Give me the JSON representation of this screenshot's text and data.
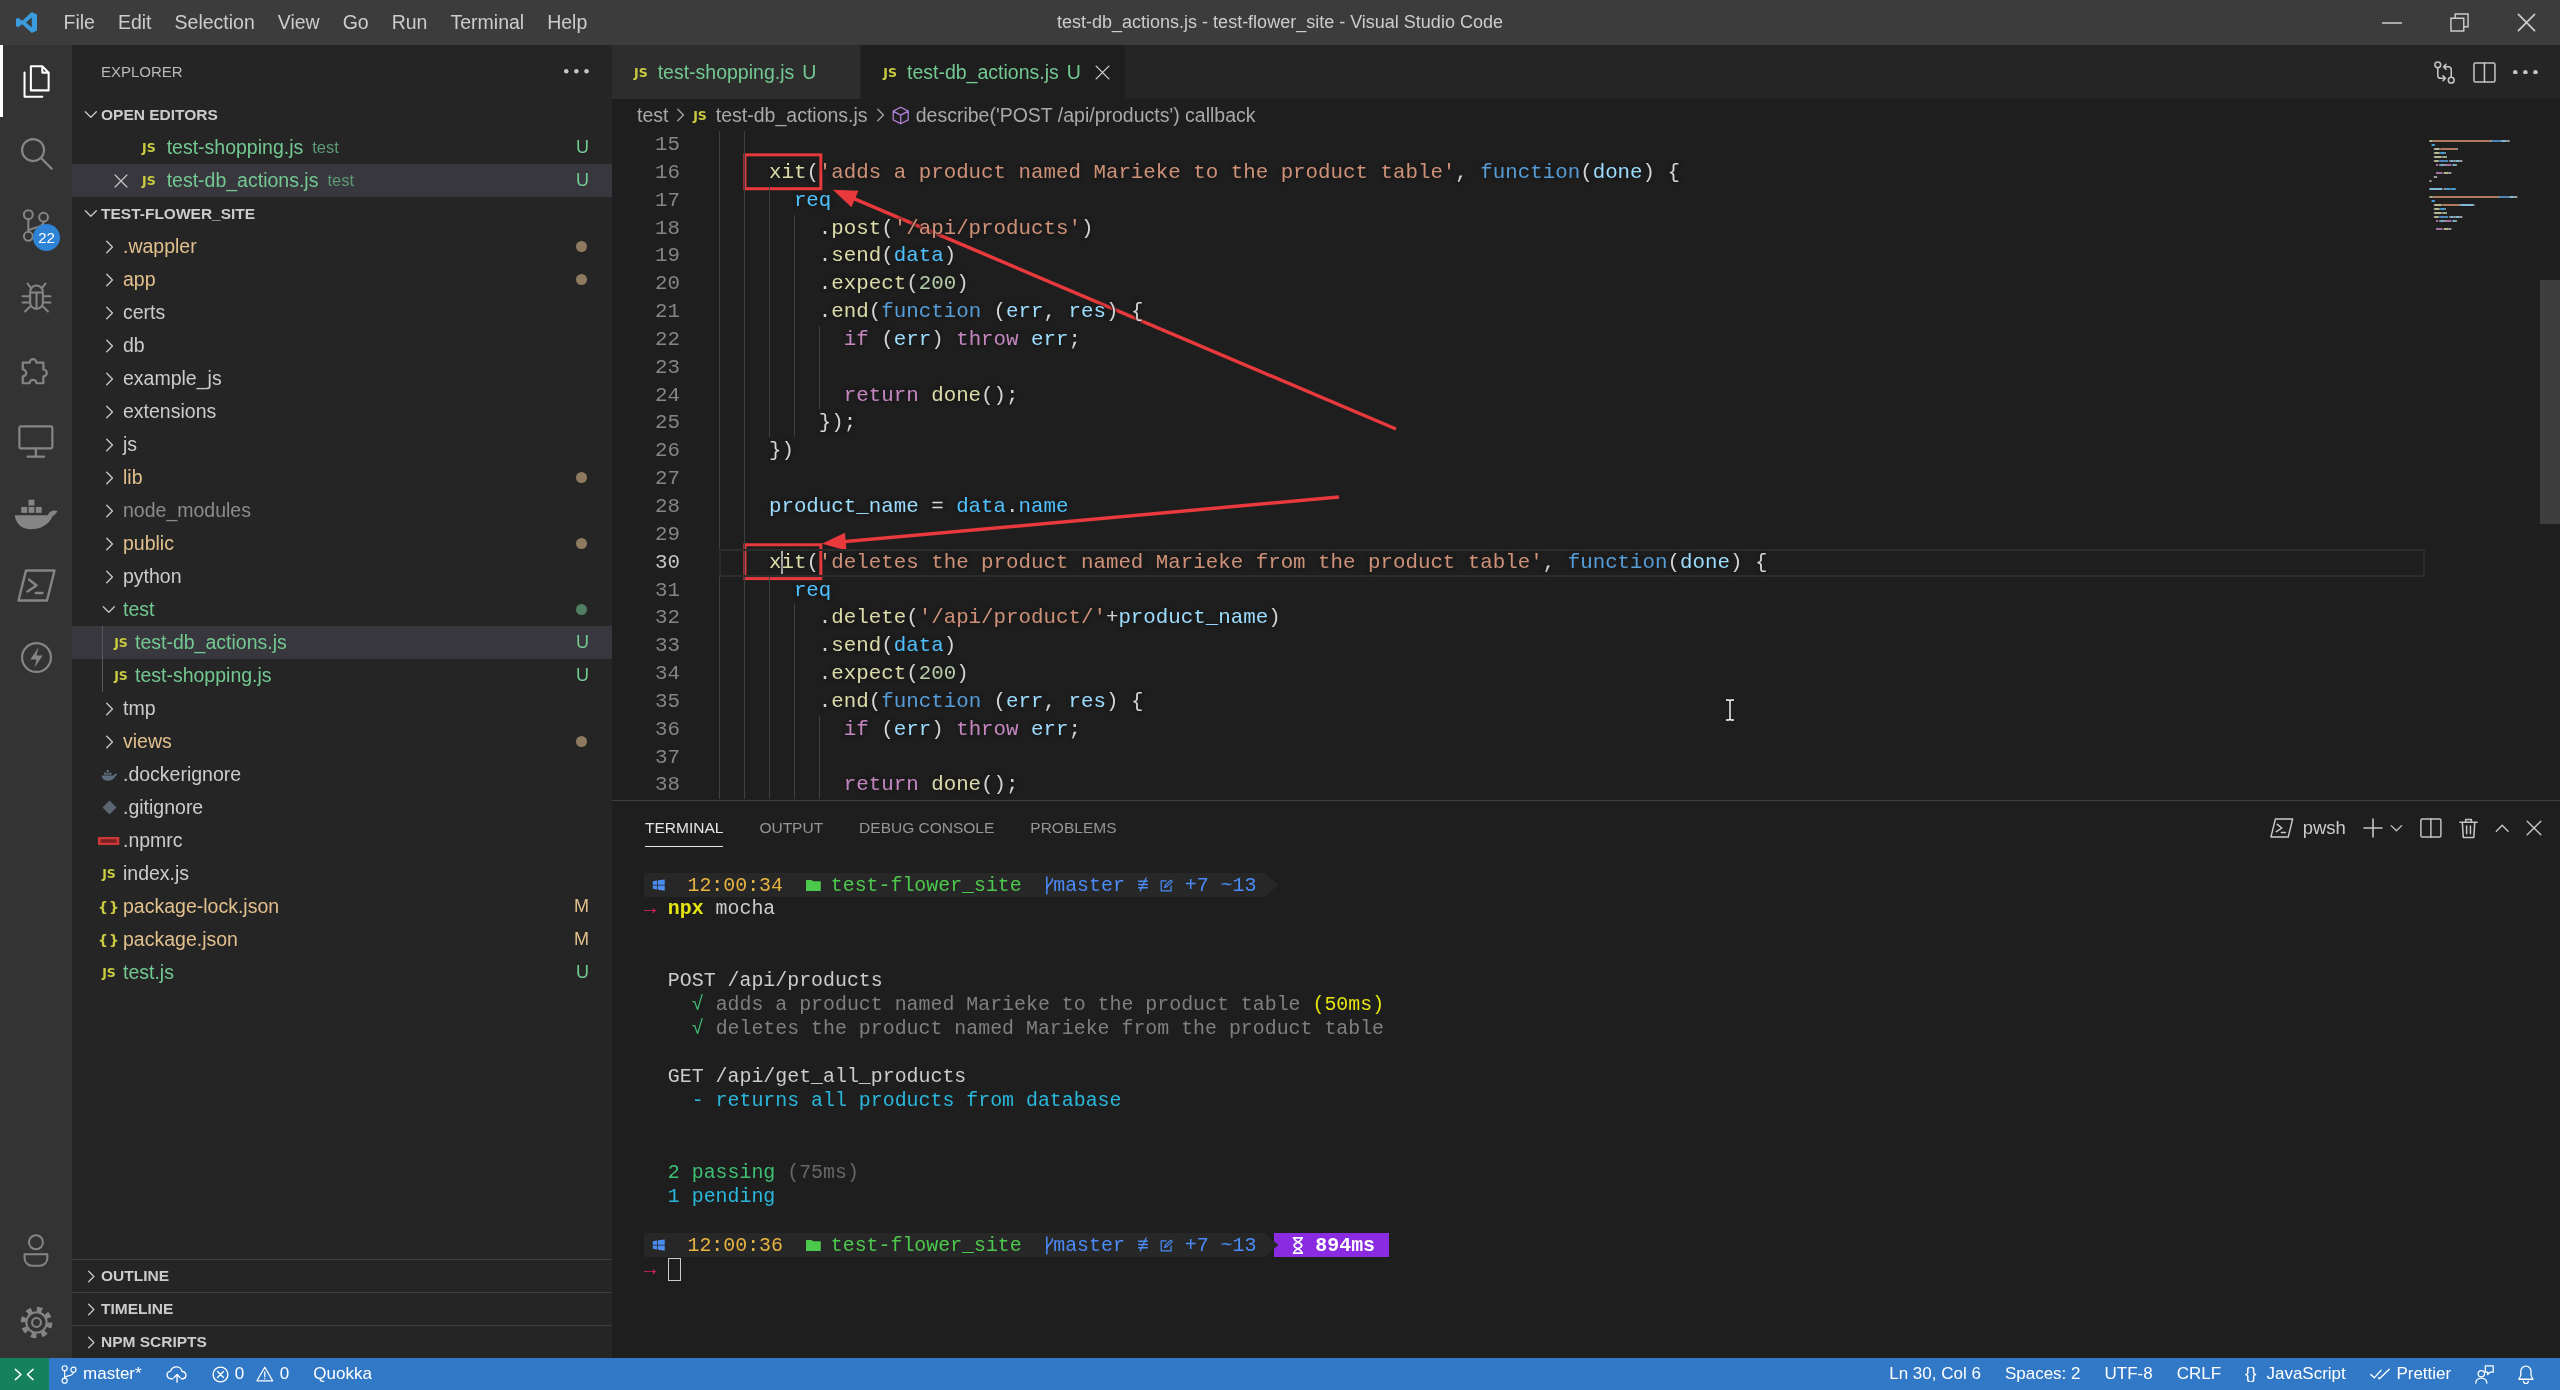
{
  "title_bar": {
    "menu": [
      "File",
      "Edit",
      "Selection",
      "View",
      "Go",
      "Run",
      "Terminal",
      "Help"
    ],
    "title": "test-db_actions.js - test-flower_site - Visual Studio Code"
  },
  "activity_bar": {
    "items": [
      {
        "kind": "files",
        "selected": true
      },
      {
        "kind": "search",
        "selected": false
      },
      {
        "kind": "branches",
        "selected": false,
        "badge": "22"
      },
      {
        "kind": "bug",
        "selected": false
      },
      {
        "kind": "puzzle",
        "selected": false
      },
      {
        "kind": "monitor",
        "selected": false
      },
      {
        "kind": "whale",
        "selected": false
      },
      {
        "kind": "terminal",
        "selected": false
      },
      {
        "kind": "lightning",
        "selected": false
      }
    ],
    "bottom": [
      {
        "kind": "person"
      },
      {
        "kind": "gear"
      }
    ]
  },
  "sidebar": {
    "title": "EXPLORER",
    "open_editors": {
      "title": "OPEN EDITORS",
      "expanded": true,
      "items": [
        {
          "kind": "js-file",
          "icon_text": "JS",
          "name": "test-shopping.js",
          "folder": "test",
          "badge": "U",
          "color": "#73c991",
          "selected": false
        },
        {
          "kind": "js-file",
          "icon_text": "JS",
          "name": "test-db_actions.js",
          "folder": "test",
          "badge": "U",
          "color": "#73c991",
          "selected": true
        }
      ]
    },
    "folder": {
      "title": "TEST-FLOWER_SITE",
      "expanded": true,
      "items": [
        {
          "kind": "folder",
          "name": ".wappler",
          "expanded": false,
          "color": "#e2c08d",
          "changed": true,
          "selected": false
        },
        {
          "kind": "folder",
          "name": "app",
          "expanded": false,
          "color": "#e2c08d",
          "changed": true,
          "selected": false
        },
        {
          "kind": "folder",
          "name": "certs",
          "expanded": false,
          "color": "#cccccc",
          "changed": false,
          "selected": false
        },
        {
          "kind": "folder",
          "name": "db",
          "expanded": false,
          "color": "#cccccc",
          "changed": false,
          "selected": false
        },
        {
          "kind": "folder",
          "name": "example_js",
          "expanded": false,
          "color": "#cccccc",
          "changed": false,
          "selected": false
        },
        {
          "kind": "folder",
          "name": "extensions",
          "expanded": false,
          "color": "#cccccc",
          "changed": false,
          "selected": false
        },
        {
          "kind": "folder",
          "name": "js",
          "expanded": false,
          "color": "#cccccc",
          "changed": false,
          "selected": false
        },
        {
          "kind": "folder",
          "name": "lib",
          "expanded": false,
          "color": "#e2c08d",
          "changed": true,
          "selected": false
        },
        {
          "kind": "folder",
          "name": "node_modules",
          "expanded": false,
          "color": "#8c8c8c",
          "changed": false,
          "selected": false
        },
        {
          "kind": "folder",
          "name": "public",
          "expanded": false,
          "color": "#e2c08d",
          "changed": true,
          "selected": false
        },
        {
          "kind": "folder",
          "name": "python",
          "expanded": false,
          "color": "#cccccc",
          "changed": false,
          "selected": false
        },
        {
          "kind": "folder",
          "name": "test",
          "expanded": true,
          "color": "#73c991",
          "changed": true,
          "selected": false,
          "children": [
            {
              "kind": "js-file",
              "icon_text": "JS",
              "name": "test-db_actions.js",
              "badge": "U",
              "color": "#73c991",
              "selected": true
            },
            {
              "kind": "js-file",
              "icon_text": "JS",
              "name": "test-shopping.js",
              "badge": "U",
              "color": "#73c991",
              "selected": false
            }
          ]
        },
        {
          "kind": "folder",
          "name": "tmp",
          "expanded": false,
          "color": "#cccccc",
          "changed": false,
          "selected": false
        },
        {
          "kind": "folder",
          "name": "views",
          "expanded": false,
          "color": "#e2c08d",
          "changed": true,
          "selected": false
        },
        {
          "kind": "docker-file",
          "name": ".dockerignore",
          "color": "#cccccc",
          "selected": false
        },
        {
          "kind": "git-file",
          "name": ".gitignore",
          "color": "#cccccc",
          "selected": false
        },
        {
          "kind": "npm-file",
          "name": ".npmrc",
          "color": "#cccccc",
          "selected": false
        },
        {
          "kind": "js-file",
          "icon_text": "JS",
          "name": "index.js",
          "color": "#cccccc",
          "selected": false
        },
        {
          "kind": "json-file",
          "icon_text": "{}",
          "name": "package-lock.json",
          "badge": "M",
          "color": "#e2c08d",
          "selected": false
        },
        {
          "kind": "json-file",
          "icon_text": "{}",
          "name": "package.json",
          "badge": "M",
          "color": "#e2c08d",
          "selected": false
        },
        {
          "kind": "js-file",
          "icon_text": "JS",
          "name": "test.js",
          "badge": "U",
          "color": "#73c991",
          "selected": false
        }
      ]
    },
    "sections": [
      {
        "title": "OUTLINE",
        "expanded": false
      },
      {
        "title": "TIMELINE",
        "expanded": false
      },
      {
        "title": "NPM SCRIPTS",
        "expanded": false
      }
    ]
  },
  "editor": {
    "tabs": [
      {
        "icon_text": "JS",
        "label": "test-shopping.js",
        "badge": "U",
        "selected": false
      },
      {
        "icon_text": "JS",
        "label": "test-db_actions.js",
        "badge": "U",
        "selected": true
      }
    ],
    "breadcrumb": [
      {
        "kind": "folder",
        "label": "test"
      },
      {
        "kind": "file",
        "icon_text": "JS",
        "label": "test-db_actions.js"
      },
      {
        "kind": "symbol",
        "label": "describe('POST /api/products') callback"
      }
    ],
    "lines": [
      {
        "number": "15",
        "current": false,
        "callout": false
      },
      {
        "number": "16",
        "current": false,
        "callout": true,
        "tokens": [
          {
            "kind": "function",
            "text": "    xit"
          },
          {
            "kind": "plain",
            "text": "("
          },
          {
            "kind": "string",
            "text": "'adds a product named Marieke to the product table'"
          },
          {
            "kind": "plain",
            "text": ", "
          },
          {
            "kind": "keyword",
            "text": "function"
          },
          {
            "kind": "plain",
            "text": "("
          },
          {
            "kind": "variable",
            "text": "done"
          },
          {
            "kind": "plain",
            "text": ") {"
          }
        ]
      },
      {
        "number": "17",
        "current": false,
        "callout": false,
        "tokens": [
          {
            "kind": "constant",
            "text": "      req"
          }
        ]
      },
      {
        "number": "18",
        "current": false,
        "callout": false,
        "tokens": [
          {
            "kind": "plain",
            "text": "        ."
          },
          {
            "kind": "function",
            "text": "post"
          },
          {
            "kind": "plain",
            "text": "("
          },
          {
            "kind": "string",
            "text": "'/api/products'"
          },
          {
            "kind": "plain",
            "text": ")"
          }
        ]
      },
      {
        "number": "19",
        "current": false,
        "callout": false,
        "tokens": [
          {
            "kind": "plain",
            "text": "        ."
          },
          {
            "kind": "function",
            "text": "send"
          },
          {
            "kind": "plain",
            "text": "("
          },
          {
            "kind": "constant",
            "text": "data"
          },
          {
            "kind": "plain",
            "text": ")"
          }
        ]
      },
      {
        "number": "20",
        "current": false,
        "callout": false,
        "tokens": [
          {
            "kind": "plain",
            "text": "        ."
          },
          {
            "kind": "function",
            "text": "expect"
          },
          {
            "kind": "plain",
            "text": "("
          },
          {
            "kind": "number",
            "text": "200"
          },
          {
            "kind": "plain",
            "text": ")"
          }
        ]
      },
      {
        "number": "21",
        "current": false,
        "callout": false,
        "tokens": [
          {
            "kind": "plain",
            "text": "        ."
          },
          {
            "kind": "function",
            "text": "end"
          },
          {
            "kind": "plain",
            "text": "("
          },
          {
            "kind": "keyword",
            "text": "function"
          },
          {
            "kind": "plain",
            "text": " ("
          },
          {
            "kind": "variable",
            "text": "err"
          },
          {
            "kind": "plain",
            "text": ", "
          },
          {
            "kind": "variable",
            "text": "res"
          },
          {
            "kind": "plain",
            "text": ") {"
          }
        ]
      },
      {
        "number": "22",
        "current": false,
        "callout": false,
        "tokens": [
          {
            "kind": "control",
            "text": "          if"
          },
          {
            "kind": "plain",
            "text": " ("
          },
          {
            "kind": "variable",
            "text": "err"
          },
          {
            "kind": "plain",
            "text": ") "
          },
          {
            "kind": "control",
            "text": "throw"
          },
          {
            "kind": "variable",
            "text": " err"
          },
          {
            "kind": "plain",
            "text": ";"
          }
        ]
      },
      {
        "number": "23",
        "current": false,
        "callout": false
      },
      {
        "number": "24",
        "current": false,
        "callout": false,
        "tokens": [
          {
            "kind": "control",
            "text": "          return"
          },
          {
            "kind": "function",
            "text": " done"
          },
          {
            "kind": "plain",
            "text": "();"
          }
        ]
      },
      {
        "number": "25",
        "current": false,
        "callout": false,
        "tokens": [
          {
            "kind": "plain",
            "text": "        });"
          }
        ]
      },
      {
        "number": "26",
        "current": false,
        "callout": false,
        "tokens": [
          {
            "kind": "plain",
            "text": "    })"
          }
        ]
      },
      {
        "number": "27",
        "current": false,
        "callout": false
      },
      {
        "number": "28",
        "current": false,
        "callout": false,
        "tokens": [
          {
            "kind": "variable",
            "text": "    product_name"
          },
          {
            "kind": "plain",
            "text": " = "
          },
          {
            "kind": "constant",
            "text": "data"
          },
          {
            "kind": "plain",
            "text": "."
          },
          {
            "kind": "constant",
            "text": "name"
          }
        ]
      },
      {
        "number": "29",
        "current": false,
        "callout": false
      },
      {
        "number": "30",
        "current": true,
        "callout": true,
        "tokens": [
          {
            "kind": "function",
            "text": "    x"
          },
          {
            "kind": "caret"
          },
          {
            "kind": "function",
            "text": "it"
          },
          {
            "kind": "plain",
            "text": "("
          },
          {
            "kind": "string",
            "text": "'deletes the product named Marieke from the product table'"
          },
          {
            "kind": "plain",
            "text": ", "
          },
          {
            "kind": "keyword",
            "text": "function"
          },
          {
            "kind": "plain",
            "text": "("
          },
          {
            "kind": "variable",
            "text": "done"
          },
          {
            "kind": "plain",
            "text": ") {"
          }
        ]
      },
      {
        "number": "31",
        "current": false,
        "callout": false,
        "tokens": [
          {
            "kind": "constant",
            "text": "      req"
          }
        ]
      },
      {
        "number": "32",
        "current": false,
        "callout": false,
        "tokens": [
          {
            "kind": "plain",
            "text": "        ."
          },
          {
            "kind": "function",
            "text": "delete"
          },
          {
            "kind": "plain",
            "text": "("
          },
          {
            "kind": "string",
            "text": "'/api/product/'"
          },
          {
            "kind": "plain",
            "text": "+"
          },
          {
            "kind": "variable",
            "text": "product_name"
          },
          {
            "kind": "plain",
            "text": ")"
          }
        ]
      },
      {
        "number": "33",
        "current": false,
        "callout": false,
        "tokens": [
          {
            "kind": "plain",
            "text": "        ."
          },
          {
            "kind": "function",
            "text": "send"
          },
          {
            "kind": "plain",
            "text": "("
          },
          {
            "kind": "constant",
            "text": "data"
          },
          {
            "kind": "plain",
            "text": ")"
          }
        ]
      },
      {
        "number": "34",
        "current": false,
        "callout": false,
        "tokens": [
          {
            "kind": "plain",
            "text": "        ."
          },
          {
            "kind": "function",
            "text": "expect"
          },
          {
            "kind": "plain",
            "text": "("
          },
          {
            "kind": "number",
            "text": "200"
          },
          {
            "kind": "plain",
            "text": ")"
          }
        ]
      },
      {
        "number": "35",
        "current": false,
        "callout": false,
        "tokens": [
          {
            "kind": "plain",
            "text": "        ."
          },
          {
            "kind": "function",
            "text": "end"
          },
          {
            "kind": "plain",
            "text": "("
          },
          {
            "kind": "keyword",
            "text": "function"
          },
          {
            "kind": "plain",
            "text": " ("
          },
          {
            "kind": "variable",
            "text": "err"
          },
          {
            "kind": "plain",
            "text": ", "
          },
          {
            "kind": "variable",
            "text": "res"
          },
          {
            "kind": "plain",
            "text": ") {"
          }
        ]
      },
      {
        "number": "36",
        "current": false,
        "callout": false,
        "tokens": [
          {
            "kind": "control",
            "text": "          if"
          },
          {
            "kind": "plain",
            "text": " ("
          },
          {
            "kind": "variable",
            "text": "err"
          },
          {
            "kind": "plain",
            "text": ") "
          },
          {
            "kind": "control",
            "text": "throw"
          },
          {
            "kind": "variable",
            "text": " err"
          },
          {
            "kind": "plain",
            "text": ";"
          }
        ]
      },
      {
        "number": "37",
        "current": false,
        "callout": false
      },
      {
        "number": "38",
        "current": false,
        "callout": false,
        "tokens": [
          {
            "kind": "control",
            "text": "          return"
          },
          {
            "kind": "function",
            "text": " done"
          },
          {
            "kind": "plain",
            "text": "();"
          }
        ]
      }
    ]
  },
  "panel": {
    "tabs": [
      {
        "label": "TERMINAL",
        "selected": true
      },
      {
        "label": "OUTPUT",
        "selected": false
      },
      {
        "label": "DEBUG CONSOLE",
        "selected": false
      },
      {
        "label": "PROBLEMS",
        "selected": false
      }
    ],
    "shell": "pwsh",
    "terminal": [
      {
        "kind": "prompt",
        "time": "12:00:34",
        "folder": "test-flower_site",
        "branch": "master",
        "sync": "≢",
        "changes": "+7 ~13"
      },
      {
        "kind": "command",
        "arrow": "→",
        "segments": [
          {
            "kind": "command",
            "text": "npx"
          },
          {
            "kind": "plain",
            "text": " mocha"
          }
        ]
      },
      {
        "kind": "blank"
      },
      {
        "kind": "blank"
      },
      {
        "kind": "output",
        "segments": [
          {
            "kind": "plain",
            "text": "  POST /api/products"
          }
        ]
      },
      {
        "kind": "output",
        "segments": [
          {
            "kind": "pass",
            "text": "    √ "
          },
          {
            "kind": "muted",
            "text": "adds a product named Marieke to the product table "
          },
          {
            "kind": "slow",
            "text": "(50ms)"
          }
        ]
      },
      {
        "kind": "output",
        "segments": [
          {
            "kind": "pass",
            "text": "    √ "
          },
          {
            "kind": "muted",
            "text": "deletes the product named Marieke from the product table"
          }
        ]
      },
      {
        "kind": "blank"
      },
      {
        "kind": "output",
        "segments": [
          {
            "kind": "plain",
            "text": "  GET /api/get_all_products"
          }
        ]
      },
      {
        "kind": "output",
        "segments": [
          {
            "kind": "pending",
            "text": "    - returns all products from database"
          }
        ]
      },
      {
        "kind": "blank"
      },
      {
        "kind": "blank"
      },
      {
        "kind": "output",
        "segments": [
          {
            "kind": "pass",
            "text": "  2 passing "
          },
          {
            "kind": "dim",
            "text": "(75ms)"
          }
        ]
      },
      {
        "kind": "output",
        "segments": [
          {
            "kind": "pending",
            "text": "  1 pending"
          }
        ]
      },
      {
        "kind": "blank"
      },
      {
        "kind": "prompt",
        "time": "12:00:36",
        "folder": "test-flower_site",
        "branch": "master",
        "sync": "≢",
        "changes": "+7 ~13",
        "duration": "894ms"
      },
      {
        "kind": "input",
        "arrow": "→"
      }
    ]
  },
  "status_bar": {
    "left": [
      {
        "kind": "remote"
      },
      {
        "kind": "branch",
        "text": "master*"
      },
      {
        "kind": "sync"
      },
      {
        "kind": "problems",
        "errors": "0",
        "warnings": "0"
      },
      {
        "kind": "plain",
        "text": "Quokka"
      }
    ],
    "right": [
      {
        "kind": "plain",
        "text": "Ln 30, Col 6"
      },
      {
        "kind": "plain",
        "text": "Spaces: 2"
      },
      {
        "kind": "plain",
        "text": "UTF-8"
      },
      {
        "kind": "plain",
        "text": "CRLF"
      },
      {
        "kind": "language",
        "icon_text": "{}",
        "text": "JavaScript"
      },
      {
        "kind": "formatter",
        "text": "Prettier"
      },
      {
        "kind": "feedback"
      },
      {
        "kind": "bell"
      }
    ]
  }
}
